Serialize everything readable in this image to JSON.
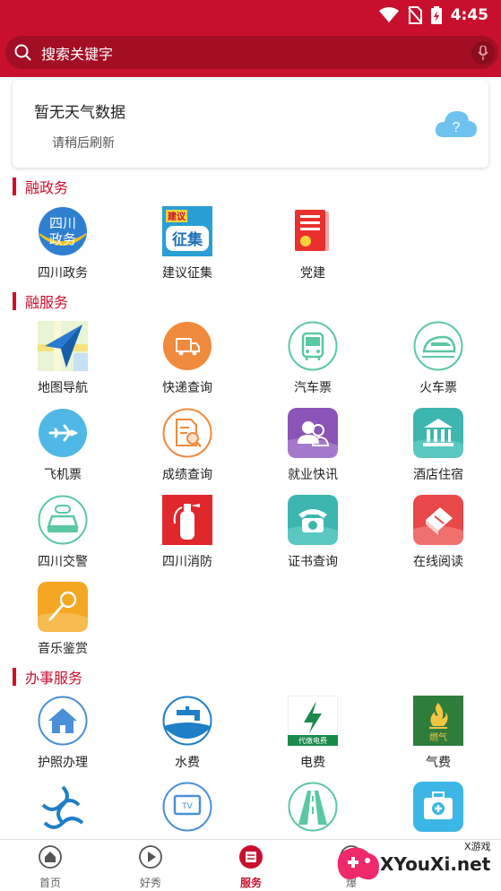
{
  "status_bar": {
    "time": "4:45"
  },
  "search": {
    "placeholder": "搜索关键字"
  },
  "weather": {
    "title": "暂无天气数据",
    "subtitle": "请稍后刷新",
    "cloud_mark": "?"
  },
  "sections": {
    "gov": {
      "title": "融政务",
      "items": [
        "四川政务",
        "建议征集",
        "党建"
      ]
    },
    "service": {
      "title": "融服务",
      "items": [
        "地图导航",
        "快递查询",
        "汽车票",
        "火车票",
        "飞机票",
        "成绩查询",
        "就业快讯",
        "酒店住宿",
        "四川交警",
        "四川消防",
        "证书查询",
        "在线阅读",
        "音乐鉴赏"
      ]
    },
    "affairs": {
      "title": "办事服务",
      "items": [
        "护照办理",
        "水费",
        "电费",
        "气费"
      ]
    }
  },
  "icon_text": {
    "sichuan_gov_line1": "四川",
    "sichuan_gov_line2": "政务",
    "suggest_top": "建议",
    "suggest_main": "征集",
    "electric_caption": "代缴电费",
    "gas_caption": "燃气",
    "tv": "TV"
  },
  "bottom_nav": {
    "items": [
      "首页",
      "好秀",
      "服务",
      "爆"
    ]
  },
  "watermark": {
    "text": "XYouXi.net",
    "small": "X游戏"
  },
  "colors": {
    "brand_red": "#c8102e",
    "search_bg": "#a30e25",
    "section_red": "#d0102a"
  }
}
